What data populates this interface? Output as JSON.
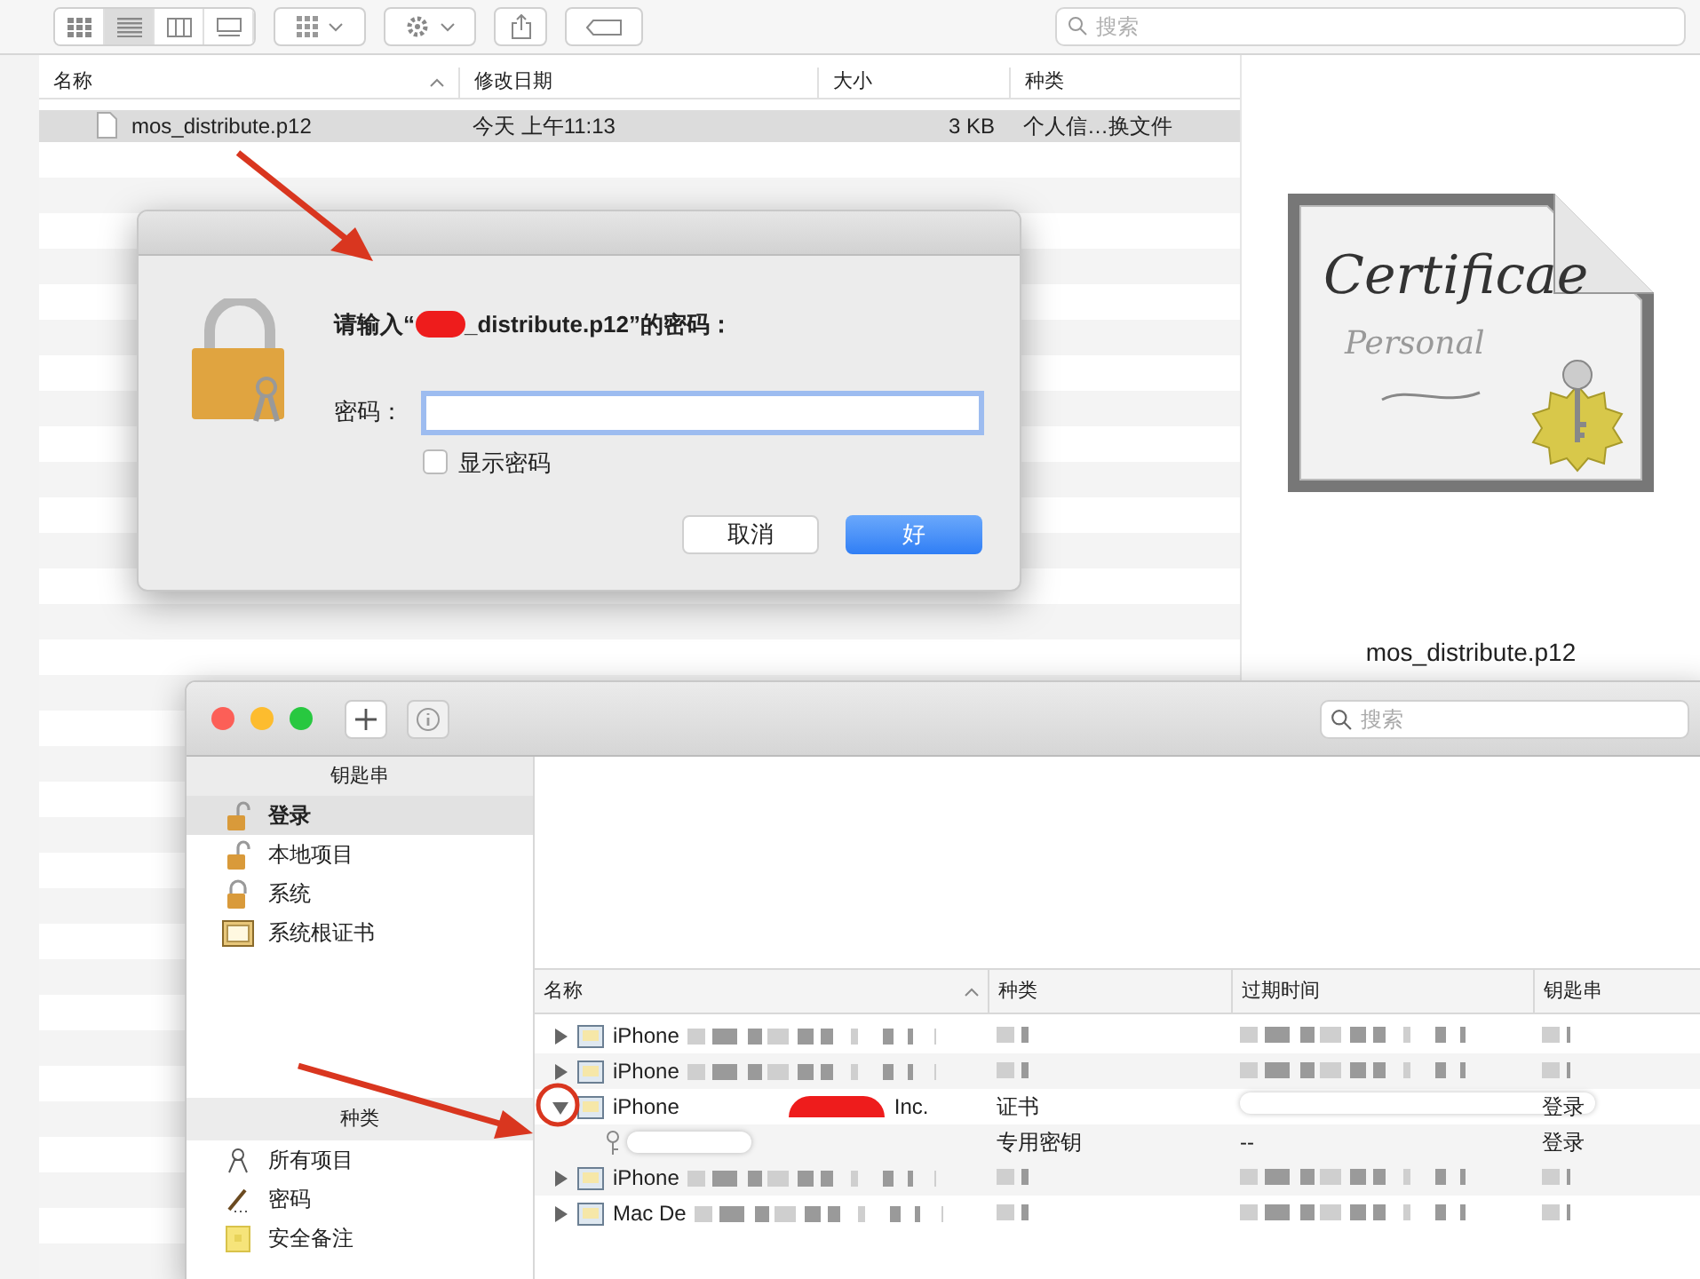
{
  "finder": {
    "toolbar": {
      "view_modes": [
        {
          "selected": false
        },
        {
          "selected": true
        },
        {
          "selected": false
        },
        {
          "selected": false
        }
      ],
      "search": {
        "placeholder": "搜索"
      }
    },
    "columns": [
      "名称",
      "修改日期",
      "大小",
      "种类"
    ],
    "files": [
      {
        "name": "mos_distribute.p12",
        "modified": "今天 上午11:13",
        "size": "3 KB",
        "kind": "个人信…换文件",
        "selected": true
      }
    ],
    "preview": {
      "icon_title": "Certificae",
      "icon_subtitle": "Personal",
      "filename": "mos_distribute.p12"
    }
  },
  "password_dialog": {
    "prompt_start": "请输入“",
    "prompt_end": "_distribute.p12”的密码：",
    "field_label": "密码：",
    "show_password": {
      "label": "显示密码",
      "checked": false
    },
    "buttons": [
      {
        "label": "取消",
        "kind": "secondary"
      },
      {
        "label": "好",
        "kind": "primary"
      }
    ]
  },
  "keychain_window": {
    "search": {
      "placeholder": "搜索"
    },
    "keychains_header": "钥匙串",
    "keychains": [
      {
        "label": "登录",
        "selected": true,
        "kind": "unlocked"
      },
      {
        "label": "本地项目",
        "selected": false,
        "kind": "unlocked"
      },
      {
        "label": "系统",
        "selected": false,
        "kind": "locked"
      },
      {
        "label": "系统根证书",
        "selected": false,
        "kind": "cabinet"
      }
    ],
    "category_header": "种类",
    "categories": [
      {
        "label": "所有项目",
        "kind": "all"
      },
      {
        "label": "密码",
        "kind": "password"
      },
      {
        "label": "安全备注",
        "kind": "note"
      }
    ],
    "columns": [
      "名称",
      "种类",
      "过期时间",
      "钥匙串"
    ],
    "items": [
      {
        "name": "iPhone",
        "expanded": false
      },
      {
        "name": "iPhone",
        "expanded": false
      },
      {
        "name": "iPhone",
        "name_end": "Inc.",
        "type": "证书",
        "keychain": "登录",
        "expanded": true,
        "children": [
          {
            "type": "专用密钥",
            "expires": "--",
            "keychain": "登录"
          }
        ]
      },
      {
        "name": "iPhone",
        "expanded": false
      },
      {
        "name": "Mac De",
        "expanded": false
      }
    ]
  }
}
